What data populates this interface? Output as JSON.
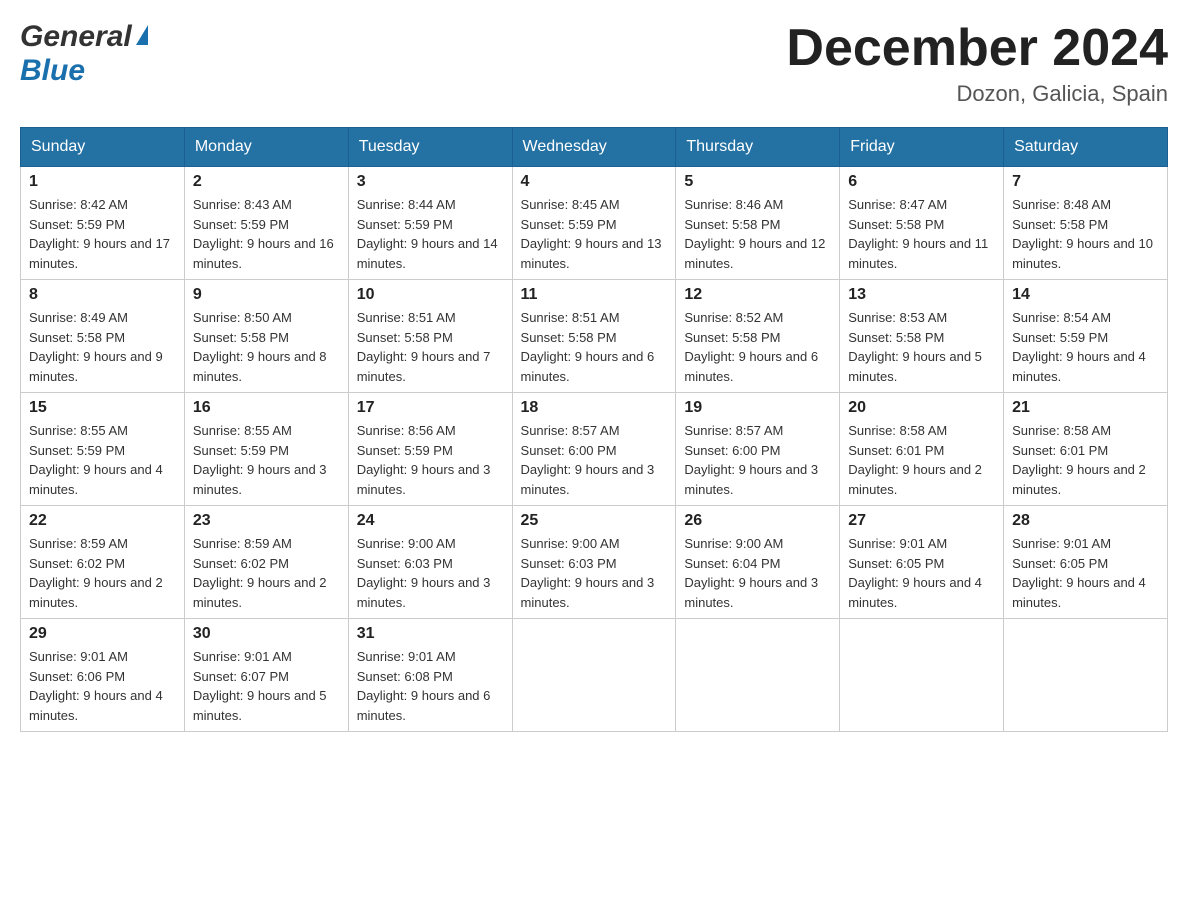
{
  "header": {
    "logo_general": "General",
    "logo_blue": "Blue",
    "month_title": "December 2024",
    "location": "Dozon, Galicia, Spain"
  },
  "days_of_week": [
    "Sunday",
    "Monday",
    "Tuesday",
    "Wednesday",
    "Thursday",
    "Friday",
    "Saturday"
  ],
  "weeks": [
    [
      {
        "day": "1",
        "sunrise": "Sunrise: 8:42 AM",
        "sunset": "Sunset: 5:59 PM",
        "daylight": "Daylight: 9 hours and 17 minutes."
      },
      {
        "day": "2",
        "sunrise": "Sunrise: 8:43 AM",
        "sunset": "Sunset: 5:59 PM",
        "daylight": "Daylight: 9 hours and 16 minutes."
      },
      {
        "day": "3",
        "sunrise": "Sunrise: 8:44 AM",
        "sunset": "Sunset: 5:59 PM",
        "daylight": "Daylight: 9 hours and 14 minutes."
      },
      {
        "day": "4",
        "sunrise": "Sunrise: 8:45 AM",
        "sunset": "Sunset: 5:59 PM",
        "daylight": "Daylight: 9 hours and 13 minutes."
      },
      {
        "day": "5",
        "sunrise": "Sunrise: 8:46 AM",
        "sunset": "Sunset: 5:58 PM",
        "daylight": "Daylight: 9 hours and 12 minutes."
      },
      {
        "day": "6",
        "sunrise": "Sunrise: 8:47 AM",
        "sunset": "Sunset: 5:58 PM",
        "daylight": "Daylight: 9 hours and 11 minutes."
      },
      {
        "day": "7",
        "sunrise": "Sunrise: 8:48 AM",
        "sunset": "Sunset: 5:58 PM",
        "daylight": "Daylight: 9 hours and 10 minutes."
      }
    ],
    [
      {
        "day": "8",
        "sunrise": "Sunrise: 8:49 AM",
        "sunset": "Sunset: 5:58 PM",
        "daylight": "Daylight: 9 hours and 9 minutes."
      },
      {
        "day": "9",
        "sunrise": "Sunrise: 8:50 AM",
        "sunset": "Sunset: 5:58 PM",
        "daylight": "Daylight: 9 hours and 8 minutes."
      },
      {
        "day": "10",
        "sunrise": "Sunrise: 8:51 AM",
        "sunset": "Sunset: 5:58 PM",
        "daylight": "Daylight: 9 hours and 7 minutes."
      },
      {
        "day": "11",
        "sunrise": "Sunrise: 8:51 AM",
        "sunset": "Sunset: 5:58 PM",
        "daylight": "Daylight: 9 hours and 6 minutes."
      },
      {
        "day": "12",
        "sunrise": "Sunrise: 8:52 AM",
        "sunset": "Sunset: 5:58 PM",
        "daylight": "Daylight: 9 hours and 6 minutes."
      },
      {
        "day": "13",
        "sunrise": "Sunrise: 8:53 AM",
        "sunset": "Sunset: 5:58 PM",
        "daylight": "Daylight: 9 hours and 5 minutes."
      },
      {
        "day": "14",
        "sunrise": "Sunrise: 8:54 AM",
        "sunset": "Sunset: 5:59 PM",
        "daylight": "Daylight: 9 hours and 4 minutes."
      }
    ],
    [
      {
        "day": "15",
        "sunrise": "Sunrise: 8:55 AM",
        "sunset": "Sunset: 5:59 PM",
        "daylight": "Daylight: 9 hours and 4 minutes."
      },
      {
        "day": "16",
        "sunrise": "Sunrise: 8:55 AM",
        "sunset": "Sunset: 5:59 PM",
        "daylight": "Daylight: 9 hours and 3 minutes."
      },
      {
        "day": "17",
        "sunrise": "Sunrise: 8:56 AM",
        "sunset": "Sunset: 5:59 PM",
        "daylight": "Daylight: 9 hours and 3 minutes."
      },
      {
        "day": "18",
        "sunrise": "Sunrise: 8:57 AM",
        "sunset": "Sunset: 6:00 PM",
        "daylight": "Daylight: 9 hours and 3 minutes."
      },
      {
        "day": "19",
        "sunrise": "Sunrise: 8:57 AM",
        "sunset": "Sunset: 6:00 PM",
        "daylight": "Daylight: 9 hours and 3 minutes."
      },
      {
        "day": "20",
        "sunrise": "Sunrise: 8:58 AM",
        "sunset": "Sunset: 6:01 PM",
        "daylight": "Daylight: 9 hours and 2 minutes."
      },
      {
        "day": "21",
        "sunrise": "Sunrise: 8:58 AM",
        "sunset": "Sunset: 6:01 PM",
        "daylight": "Daylight: 9 hours and 2 minutes."
      }
    ],
    [
      {
        "day": "22",
        "sunrise": "Sunrise: 8:59 AM",
        "sunset": "Sunset: 6:02 PM",
        "daylight": "Daylight: 9 hours and 2 minutes."
      },
      {
        "day": "23",
        "sunrise": "Sunrise: 8:59 AM",
        "sunset": "Sunset: 6:02 PM",
        "daylight": "Daylight: 9 hours and 2 minutes."
      },
      {
        "day": "24",
        "sunrise": "Sunrise: 9:00 AM",
        "sunset": "Sunset: 6:03 PM",
        "daylight": "Daylight: 9 hours and 3 minutes."
      },
      {
        "day": "25",
        "sunrise": "Sunrise: 9:00 AM",
        "sunset": "Sunset: 6:03 PM",
        "daylight": "Daylight: 9 hours and 3 minutes."
      },
      {
        "day": "26",
        "sunrise": "Sunrise: 9:00 AM",
        "sunset": "Sunset: 6:04 PM",
        "daylight": "Daylight: 9 hours and 3 minutes."
      },
      {
        "day": "27",
        "sunrise": "Sunrise: 9:01 AM",
        "sunset": "Sunset: 6:05 PM",
        "daylight": "Daylight: 9 hours and 4 minutes."
      },
      {
        "day": "28",
        "sunrise": "Sunrise: 9:01 AM",
        "sunset": "Sunset: 6:05 PM",
        "daylight": "Daylight: 9 hours and 4 minutes."
      }
    ],
    [
      {
        "day": "29",
        "sunrise": "Sunrise: 9:01 AM",
        "sunset": "Sunset: 6:06 PM",
        "daylight": "Daylight: 9 hours and 4 minutes."
      },
      {
        "day": "30",
        "sunrise": "Sunrise: 9:01 AM",
        "sunset": "Sunset: 6:07 PM",
        "daylight": "Daylight: 9 hours and 5 minutes."
      },
      {
        "day": "31",
        "sunrise": "Sunrise: 9:01 AM",
        "sunset": "Sunset: 6:08 PM",
        "daylight": "Daylight: 9 hours and 6 minutes."
      },
      null,
      null,
      null,
      null
    ]
  ]
}
